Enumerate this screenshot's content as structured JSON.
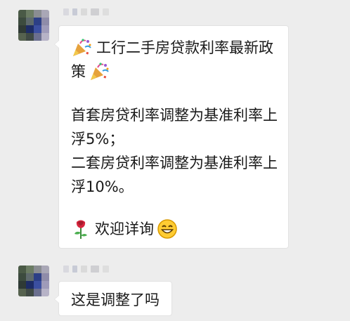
{
  "conversation": {
    "messages": [
      {
        "sender": "other",
        "lines": {
          "title_a": "工行二手房贷款利率最新政",
          "title_b": "策",
          "policy_1a": "首套房贷利率调整为基准利率上",
          "policy_1b": "浮5%；",
          "policy_2a": "二套房贷利率调整为基准利率上",
          "policy_2b": "浮10%。",
          "closing": "欢迎详询"
        },
        "icons": [
          "party-popper-icon",
          "party-popper-icon",
          "rose-icon",
          "smiling-face-icon"
        ]
      },
      {
        "sender": "other",
        "text": "这是调整了吗"
      }
    ]
  },
  "colors": {
    "background": "#ededed",
    "bubble": "#ffffff",
    "bubble_border": "#e2e2e2",
    "text": "#1a1a1a"
  }
}
